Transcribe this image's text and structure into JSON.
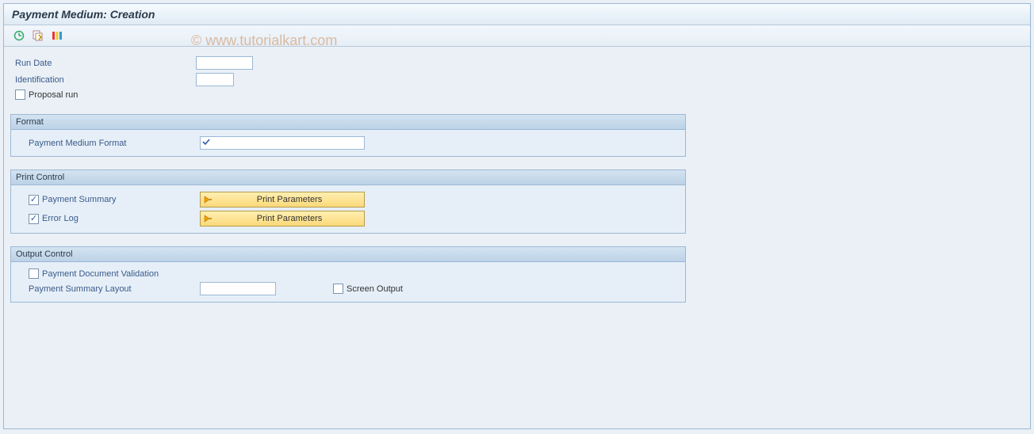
{
  "title": "Payment Medium: Creation",
  "watermark": "© www.tutorialkart.com",
  "top": {
    "run_date_label": "Run Date",
    "run_date_value": "",
    "identification_label": "Identification",
    "identification_value": "",
    "proposal_run_label": "Proposal run",
    "proposal_run_checked": false
  },
  "format_group": {
    "title": "Format",
    "pmf_label": "Payment Medium Format",
    "pmf_value": ""
  },
  "print_group": {
    "title": "Print Control",
    "payment_summary_label": "Payment Summary",
    "payment_summary_checked": true,
    "error_log_label": "Error Log",
    "error_log_checked": true,
    "print_parameters_label": "Print Parameters"
  },
  "output_group": {
    "title": "Output Control",
    "pdv_label": "Payment Document Validation",
    "pdv_checked": false,
    "psl_label": "Payment Summary Layout",
    "psl_value": "",
    "screen_output_label": "Screen Output",
    "screen_output_checked": false
  }
}
